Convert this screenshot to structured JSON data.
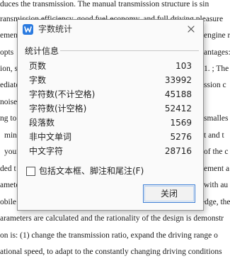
{
  "document": {
    "lines": [
      {
        "left": "duces the transmission. The manual transmission structure is sin",
        "right": ""
      },
      {
        "left": "ransmission efficiency, good fuel economy, and full driving pleasure",
        "right": ""
      },
      {
        "left": "ement",
        "right": "engine r"
      },
      {
        "left": "opts",
        "right": "antages:"
      },
      {
        "left": "ion, so",
        "right": "1. ; The"
      },
      {
        "left": "ediate",
        "right": "ssion c"
      },
      {
        "left": "noise",
        "right": ""
      },
      {
        "left": "ng to t",
        "right": "smalles"
      },
      {
        "left": "minu",
        "right": "t and t"
      },
      {
        "left": "your",
        "right": "of the c"
      },
      {
        "left": "ded t",
        "right": "ement a"
      },
      {
        "left": "ameter",
        "right": "with au"
      },
      {
        "left": "obile",
        "right": "edge, the"
      },
      {
        "left": "arameters are calculated and the rationality of the design is demonstr",
        "right": ""
      },
      {
        "left": "on is: (1) change the transmission ratio, expand the driving range o",
        "right": ""
      },
      {
        "left": "ational speed, to adapt to the constantly changing driving conditions",
        "right": ""
      }
    ]
  },
  "dialog": {
    "title": "字数统计",
    "group_title": "统计信息",
    "stats": [
      {
        "label": "页数",
        "value": "103"
      },
      {
        "label": "字数",
        "value": "33992"
      },
      {
        "label": "字符数(不计空格)",
        "value": "45188"
      },
      {
        "label": "字符数(计空格)",
        "value": "52412"
      },
      {
        "label": "段落数",
        "value": "1569"
      },
      {
        "label": "非中文单词",
        "value": "5276"
      },
      {
        "label": "中文字符",
        "value": "28716"
      }
    ],
    "checkbox_label": "包括文本框、脚注和尾注(F)",
    "checkbox_checked": false,
    "close_button_label": "关闭",
    "icons": {
      "app": "wps-writer-icon",
      "close": "close-icon"
    },
    "colors": {
      "accent": "#2b7be0",
      "button_border": "#3d7fd6"
    }
  }
}
